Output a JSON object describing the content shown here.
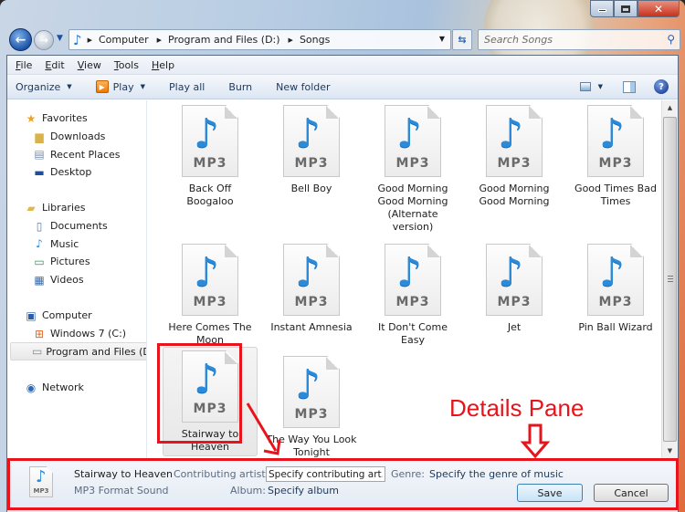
{
  "window": {
    "minimize_label": "Minimize",
    "maximize_label": "Maximize",
    "close_label": "Close"
  },
  "navigation": {
    "back_icon": "back-arrow-icon",
    "forward_icon": "forward-arrow-icon",
    "breadcrumb": [
      "Computer",
      "Program and Files (D:)",
      "Songs"
    ],
    "search_placeholder": "Search Songs"
  },
  "menubar": {
    "items": [
      {
        "label": "File",
        "accel": "F",
        "rest": "ile"
      },
      {
        "label": "Edit",
        "accel": "E",
        "rest": "dit"
      },
      {
        "label": "View",
        "accel": "V",
        "rest": "iew"
      },
      {
        "label": "Tools",
        "accel": "T",
        "rest": "ools"
      },
      {
        "label": "Help",
        "accel": "H",
        "rest": "elp"
      }
    ]
  },
  "toolbar": {
    "organize": "Organize",
    "play": "Play",
    "play_all": "Play all",
    "burn": "Burn",
    "new_folder": "New folder"
  },
  "sidebar": {
    "favorites": {
      "label": "Favorites",
      "items": [
        "Downloads",
        "Recent Places",
        "Desktop"
      ]
    },
    "libraries": {
      "label": "Libraries",
      "items": [
        "Documents",
        "Music",
        "Pictures",
        "Videos"
      ]
    },
    "computer": {
      "label": "Computer",
      "items": [
        "Windows 7 (C:)",
        "Program and Files (D:)"
      ],
      "selected": "Program and Files (D:)"
    },
    "network": {
      "label": "Network"
    }
  },
  "files": {
    "icon_label": "MP3",
    "items": [
      "Back Off Boogaloo",
      "Bell Boy",
      "Good Morning Good Morning (Alternate version)",
      "Good Morning Good Morning",
      "Good Times Bad Times",
      "Here Comes The Moon",
      "Instant Amnesia",
      "It  Don't Come Easy",
      "Jet",
      "Pin Ball Wizard",
      "Stairway to Heaven",
      "The Way You Look Tonight"
    ],
    "selected": "Stairway to Heaven"
  },
  "details_pane": {
    "icon_label": "MP3",
    "title": "Stairway to Heaven",
    "type": "MP3 Format Sound",
    "contributing_artists_label": "Contributing artists:",
    "contributing_artists_value": "Specify contributing art...",
    "album_label": "Album:",
    "album_value": "Specify album",
    "genre_label": "Genre:",
    "genre_value": "Specify the genre of music",
    "save_label": "Save",
    "cancel_label": "Cancel"
  },
  "annotations": {
    "details_pane_label": "Details Pane",
    "color": "#e8141b"
  }
}
